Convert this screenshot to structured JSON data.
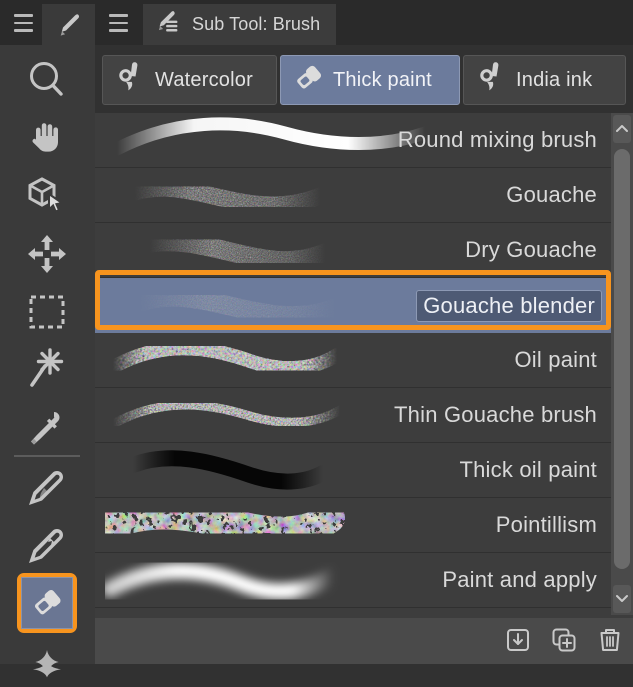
{
  "app": {
    "accent_orange": "#f7941e",
    "accent_blue": "#6c7b9c",
    "bg": "#313131"
  },
  "toolbar": {
    "menu_icon": "hamburger-menu-icon",
    "active_tool_icon": "pencil-icon",
    "tools": [
      {
        "name": "zoom-tool",
        "icon": "magnifier-icon"
      },
      {
        "name": "move-canvas-tool",
        "icon": "hand-icon"
      },
      {
        "name": "rotate-3d-tool",
        "icon": "cube-cursor-icon"
      },
      {
        "name": "move-tool",
        "icon": "four-arrows-icon"
      },
      {
        "name": "selection-tool",
        "icon": "dashed-rectangle-icon"
      },
      {
        "name": "auto-select-tool",
        "icon": "sparkle-star-icon"
      },
      {
        "name": "eyedropper-tool",
        "icon": "eyedropper-icon"
      },
      {
        "name": "pen-tool",
        "icon": "pen-nib-icon"
      },
      {
        "name": "pencil-tool",
        "icon": "pencil-tool-icon"
      },
      {
        "name": "brush-tool",
        "icon": "brush-tool-icon",
        "selected": true
      },
      {
        "name": "airbrush-tool",
        "icon": "four-point-star-icon"
      }
    ]
  },
  "header": {
    "menu_icon": "hamburger-menu-icon",
    "tab_icon": "sub-tool-icon",
    "title": "Sub Tool: Brush"
  },
  "categories": {
    "items": [
      {
        "label": "Watercolor",
        "icon": "watercolor-brush-icon",
        "active": false
      },
      {
        "label": "Thick paint",
        "icon": "thick-paint-brush-icon",
        "active": true
      },
      {
        "label": "India ink",
        "icon": "india-ink-brush-icon",
        "active": false
      }
    ]
  },
  "sub_tools": {
    "items": [
      {
        "label": "Round mixing brush",
        "stroke": "smooth-soft",
        "selected": false
      },
      {
        "label": "Gouache",
        "stroke": "grainy-short",
        "selected": false
      },
      {
        "label": "Dry Gouache",
        "stroke": "grainy-dry",
        "selected": false
      },
      {
        "label": "Gouache blender",
        "stroke": "faint-blend",
        "selected": true
      },
      {
        "label": "Oil paint",
        "stroke": "thick-textured",
        "selected": false
      },
      {
        "label": "Thin Gouache brush",
        "stroke": "thin-textured",
        "selected": false
      },
      {
        "label": "Thick oil paint",
        "stroke": "dark-thick",
        "selected": false
      },
      {
        "label": "Pointillism",
        "stroke": "chunky-speckle",
        "selected": false
      },
      {
        "label": "Paint and apply",
        "stroke": "soft-blurred",
        "selected": false
      }
    ]
  },
  "scrollbar": {
    "up_icon": "chevron-up-icon",
    "down_icon": "chevron-down-icon"
  },
  "bottom_bar": {
    "buttons": [
      {
        "name": "import-sub-tool-button",
        "icon": "download-box-icon"
      },
      {
        "name": "duplicate-sub-tool-button",
        "icon": "copy-plus-icon"
      },
      {
        "name": "delete-sub-tool-button",
        "icon": "trash-icon"
      }
    ]
  }
}
